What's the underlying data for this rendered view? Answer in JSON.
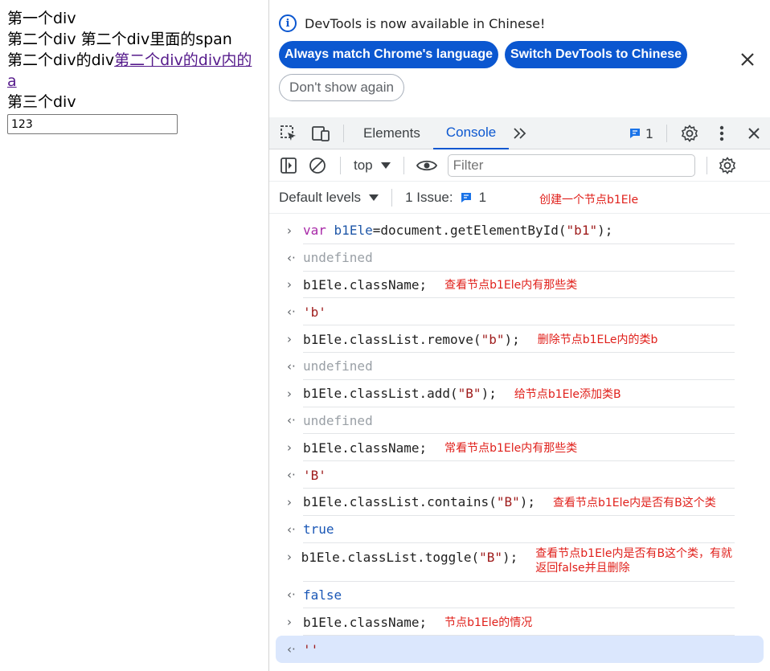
{
  "page": {
    "lines": [
      "第一个div",
      "第二个div 第二个div里面的span"
    ],
    "line3_text": "第二个div的div",
    "line3_link": "第二个div的div内的a",
    "line4": "第三个div",
    "input_value": "123"
  },
  "infobar": {
    "message": "DevTools is now available in Chinese!",
    "btn_match": "Always match Chrome's language",
    "btn_switch": "Switch DevTools to Chinese",
    "btn_dont_show": "Don't show again"
  },
  "tabs": {
    "elements": "Elements",
    "console": "Console",
    "issues_count": "1"
  },
  "toolbar": {
    "context": "top",
    "filter_placeholder": "Filter"
  },
  "levels": {
    "label": "Default levels",
    "issues_label": "1 Issue:",
    "issues_count": "1",
    "annotation": "创建一个节点b1Ele"
  },
  "console": {
    "rows": [
      {
        "type": "input",
        "code": "var b1Ele=document.getElementById(\"b1\");",
        "note": ""
      },
      {
        "type": "output",
        "code": "undefined",
        "note": ""
      },
      {
        "type": "input",
        "code": "b1Ele.className;",
        "note": "查看节点b1Ele内有那些类"
      },
      {
        "type": "output",
        "code": "'b'",
        "note": ""
      },
      {
        "type": "input",
        "code": "b1Ele.classList.remove(\"b\");",
        "note": "删除节点b1ELe内的类b"
      },
      {
        "type": "output",
        "code": "undefined",
        "note": ""
      },
      {
        "type": "input",
        "code": "b1Ele.classList.add(\"B\");",
        "note": "给节点b1Ele添加类B"
      },
      {
        "type": "output",
        "code": "undefined",
        "note": ""
      },
      {
        "type": "input",
        "code": "b1Ele.className;",
        "note": "常看节点b1Ele内有那些类"
      },
      {
        "type": "output",
        "code": "'B'",
        "note": ""
      },
      {
        "type": "input",
        "code": "b1Ele.classList.contains(\"B\");",
        "note": "查看节点b1Ele内是否有B这个类"
      },
      {
        "type": "output",
        "code": "true",
        "note": ""
      },
      {
        "type": "input",
        "code": "b1Ele.classList.toggle(\"B\");",
        "note": "查看节点b1Ele内是否有B这个类，有就返回false并且删除"
      },
      {
        "type": "output",
        "code": "false",
        "note": ""
      },
      {
        "type": "input",
        "code": "b1Ele.className;",
        "note": "节点b1Ele的情况"
      },
      {
        "type": "output",
        "code": "''",
        "note": ""
      }
    ]
  },
  "colors": {
    "accent": "#0b57d0",
    "annotation": "#e0201b",
    "highlight": "#dbe7fd"
  }
}
